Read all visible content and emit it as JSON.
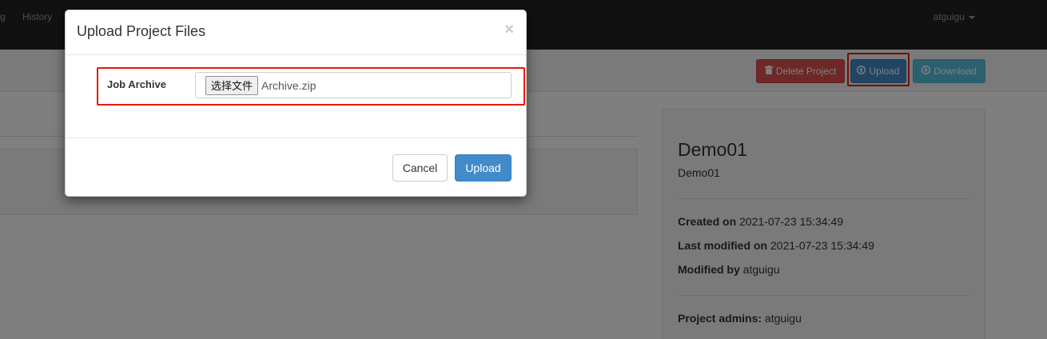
{
  "navbar": {
    "items": [
      {
        "label": "g"
      },
      {
        "label": "History"
      }
    ],
    "user": "atguigu"
  },
  "toolbar": {
    "delete_label": "Delete Project",
    "upload_label": "Upload",
    "download_label": "Download"
  },
  "project": {
    "name": "Demo01",
    "description": "Demo01",
    "created_label": "Created on",
    "created_value": "2021-07-23 15:34:49",
    "modified_label": "Last modified on",
    "modified_value": "2021-07-23 15:34:49",
    "modified_by_label": "Modified by",
    "modified_by_value": "atguigu",
    "admins_label": "Project admins:",
    "admins_value": "atguigu"
  },
  "modal": {
    "title": "Upload Project Files",
    "close": "×",
    "field_label": "Job Archive",
    "choose_button": "选择文件",
    "file_name": "Archive.zip",
    "cancel_label": "Cancel",
    "upload_label": "Upload"
  },
  "colors": {
    "navbar": "#222222",
    "danger": "#d9534f",
    "primary": "#428bca",
    "info": "#5bc0de",
    "annotation_highlight": "#e8180c"
  }
}
